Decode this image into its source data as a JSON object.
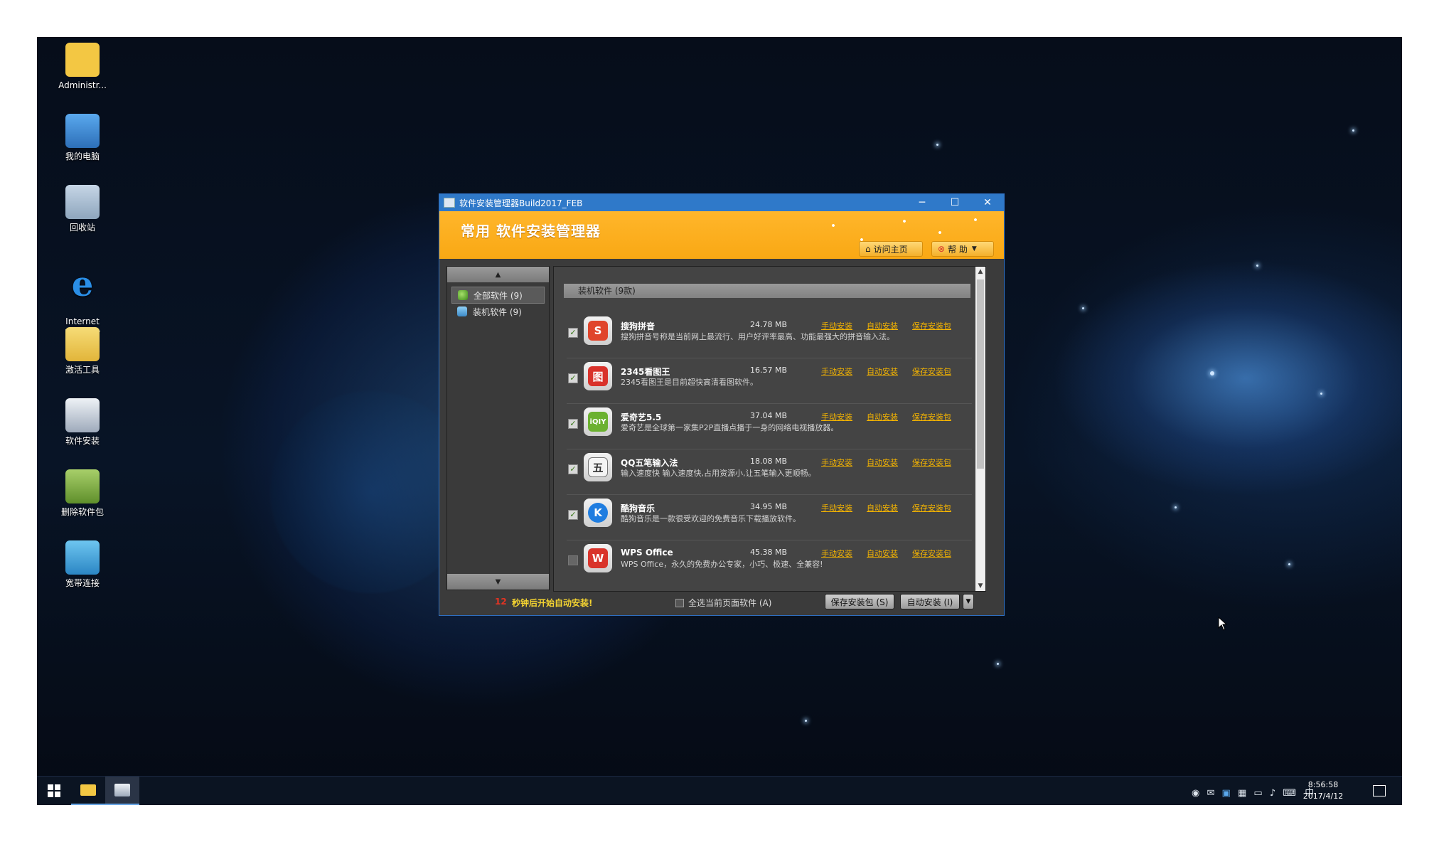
{
  "desktop": {
    "icons": [
      {
        "label": "Administr...",
        "icon": "user-folder-icon",
        "color": "#f3c743"
      },
      {
        "label": "我的电脑",
        "icon": "computer-icon",
        "color": "#3b8fd9"
      },
      {
        "label": "回收站",
        "icon": "recycle-bin-icon",
        "color": "#9fb8cf"
      },
      {
        "label": "Internet\nExplorer",
        "icon": "internet-explorer-icon",
        "color": "#2a8ee6"
      },
      {
        "label": "激活工具",
        "icon": "activate-tool-icon",
        "color": "#e8c04a"
      },
      {
        "label": "软件安装",
        "icon": "software-install-icon",
        "color": "#c9d3de"
      },
      {
        "label": "删除软件包",
        "icon": "delete-package-icon",
        "color": "#7fae3a"
      },
      {
        "label": "宽带连接",
        "icon": "broadband-connect-icon",
        "color": "#3aa7e0"
      }
    ]
  },
  "window": {
    "title": "软件安装管理器Build2017_FEB",
    "brand": "常用  软件安装管理器",
    "visit_home": "访问主页",
    "help": "帮 助",
    "min": "─",
    "max": "☐",
    "close": "✕",
    "accent": "#f9a814",
    "titlebar_color": "#2f79c9"
  },
  "categories": [
    {
      "label": "全部软件 (9)",
      "selected": true
    },
    {
      "label": "装机软件 (9)",
      "selected": false
    }
  ],
  "section_title": "装机软件 (9款)",
  "link_labels": {
    "manual": "手动安装",
    "auto": "自动安装",
    "save": "保存安装包"
  },
  "software": [
    {
      "name": "搜狗拼音",
      "size": "24.78 MB",
      "desc": "搜狗拼音号称是当前网上最流行、用户好评率最高、功能最强大的拼音输入法。",
      "checked": true,
      "icon": "sogou-icon",
      "glyph": "S",
      "color": "#e0452b"
    },
    {
      "name": "2345看图王",
      "size": "16.57 MB",
      "desc": "2345看图王是目前超快高清看图软件。",
      "checked": true,
      "icon": "2345-viewer-icon",
      "glyph": "图",
      "color": "#d9322b"
    },
    {
      "name": "爱奇艺5.5",
      "size": "37.04 MB",
      "desc": "爱奇艺是全球第一家集P2P直播点播于一身的网络电视播放器。",
      "checked": true,
      "icon": "iqiyi-icon",
      "glyph": "iQIY",
      "color": "#6bb130"
    },
    {
      "name": "QQ五笔输入法",
      "size": "18.08 MB",
      "desc": "输入速度快 输入速度快,占用资源小,让五笔输入更顺畅。",
      "checked": true,
      "icon": "qq-wubi-icon",
      "glyph": "五",
      "color": "#444444"
    },
    {
      "name": "酷狗音乐",
      "size": "34.95 MB",
      "desc": "酷狗音乐是一款很受欢迎的免费音乐下载播放软件。",
      "checked": true,
      "icon": "kugou-icon",
      "glyph": "K",
      "color": "#1f7de0"
    },
    {
      "name": "WPS Office",
      "size": "45.38 MB",
      "desc": "WPS Office，永久的免费办公专家，小巧、极速、全兼容!",
      "checked": false,
      "icon": "wps-icon",
      "glyph": "W",
      "color": "#d9342b"
    }
  ],
  "footer": {
    "countdown": "12",
    "countdown_text": "秒钟后开始自动安装!",
    "select_all": "全选当前页面软件 (A)",
    "save_btn": "保存安装包 (S)",
    "auto_btn": "自动安装 (I)"
  },
  "taskbar": {
    "time": "8:56:58",
    "date": "2017/4/12",
    "ime": "中"
  }
}
